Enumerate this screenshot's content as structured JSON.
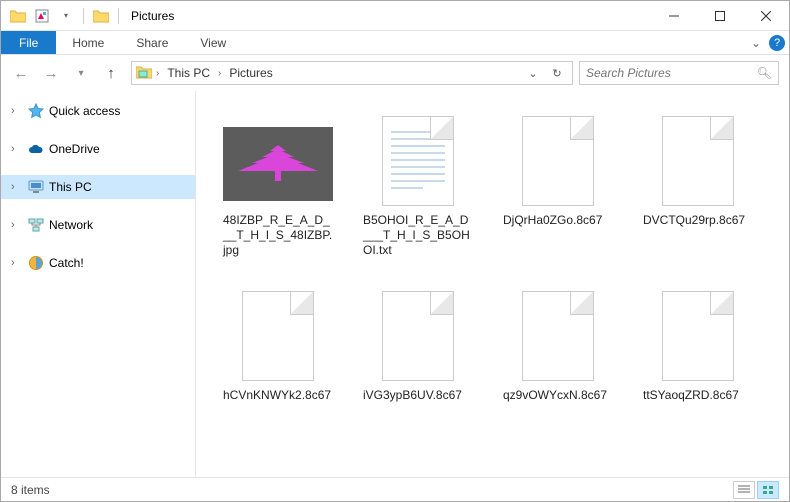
{
  "titlebar": {
    "title": "Pictures"
  },
  "ribbon": {
    "file": "File",
    "tabs": [
      "Home",
      "Share",
      "View"
    ]
  },
  "breadcrumbs": {
    "items": [
      "This PC",
      "Pictures"
    ]
  },
  "search": {
    "placeholder": "Search Pictures"
  },
  "sidebar": {
    "items": [
      {
        "label": "Quick access",
        "icon": "star"
      },
      {
        "label": "OneDrive",
        "icon": "cloud"
      },
      {
        "label": "This PC",
        "icon": "pc",
        "selected": true
      },
      {
        "label": "Network",
        "icon": "network"
      },
      {
        "label": "Catch!",
        "icon": "catch"
      }
    ]
  },
  "files": [
    {
      "name": "48IZBP_R_E_A_D___T_H_I_S_48IZBP.jpg",
      "type": "image"
    },
    {
      "name": "B5OHOI_R_E_A_D___T_H_I_S_B5OHOI.txt",
      "type": "text"
    },
    {
      "name": "DjQrHa0ZGo.8c67",
      "type": "blank"
    },
    {
      "name": "DVCTQu29rp.8c67",
      "type": "blank"
    },
    {
      "name": "hCVnKNWYk2.8c67",
      "type": "blank"
    },
    {
      "name": "iVG3ypB6UV.8c67",
      "type": "blank"
    },
    {
      "name": "qz9vOWYcxN.8c67",
      "type": "blank"
    },
    {
      "name": "ttSYaoqZRD.8c67",
      "type": "blank"
    }
  ],
  "statusbar": {
    "count": "8 items"
  }
}
